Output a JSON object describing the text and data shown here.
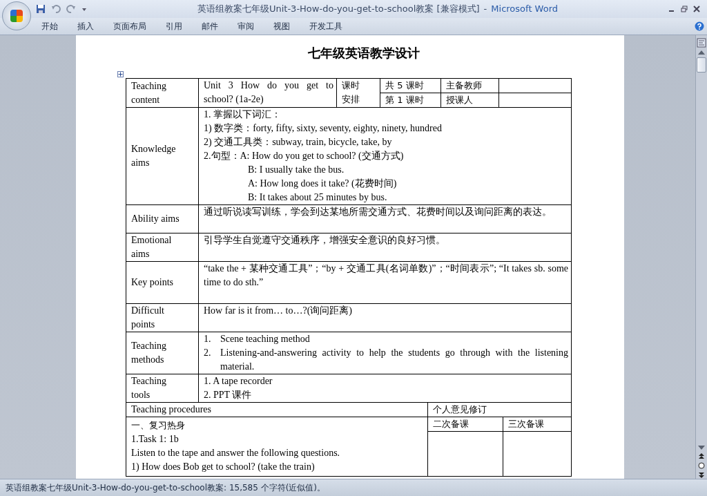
{
  "window": {
    "title": "英语组教案七年级Unit-3-How-do-you-get-to-school教案 [兼容模式]",
    "separator": "-",
    "app_name": "Microsoft Word"
  },
  "ribbon_tabs": [
    "开始",
    "插入",
    "页面布局",
    "引用",
    "邮件",
    "审阅",
    "视图",
    "开发工具"
  ],
  "document": {
    "title": "七年级英语教学设计",
    "header": {
      "label": [
        "Teaching",
        "content"
      ],
      "unit": "Unit 3 How do you get to school? (1a-2e)",
      "schedule": [
        "课时",
        "安排"
      ],
      "total": "共 5 课时",
      "current": "第 1 课时",
      "teacher_label": "主备教师",
      "lecturer_label": "授课人"
    },
    "rows": [
      {
        "label": [
          "Knowledge",
          "aims"
        ],
        "kind": "lines",
        "lines": [
          {
            "text": "1. 掌握以下词汇：",
            "indent": false
          },
          {
            "text": "1) 数字类：forty, fifty, sixty, seventy, eighty, ninety, hundred",
            "indent": false
          },
          {
            "text": "2) 交通工具类：subway, train, bicycle, take, by",
            "indent": false
          },
          {
            "text": "2.句型：A: How do you get to school?    (交通方式)",
            "indent": false
          },
          {
            "text": "B: I usually take the bus.",
            "indent": true
          },
          {
            "text": "A: How long does it take? (花费时间)",
            "indent": true
          },
          {
            "text": "B: It takes about 25 minutes by bus.",
            "indent": true
          }
        ]
      },
      {
        "label": [
          "Ability aims"
        ],
        "kind": "paragraph",
        "text": "通过听说读写训练，学会到达某地所需交通方式、花费时间以及询问距离的表达。"
      },
      {
        "label": [
          "Emotional",
          "aims"
        ],
        "kind": "paragraph",
        "text": "引导学生自觉遵守交通秩序，增强安全意识的良好习惯。"
      },
      {
        "label": [
          "Key points"
        ],
        "kind": "paragraph",
        "text": "“take the + 某种交通工具”；“by + 交通工具(名词单数)”；“时间表示”; “It takes sb. some time to do sth.”"
      },
      {
        "label": [
          "Difficult",
          "points"
        ],
        "kind": "paragraph",
        "text": "How far is it from… to…?(询问距离)"
      },
      {
        "label": [
          "Teaching",
          "methods"
        ],
        "kind": "numbered",
        "items": [
          {
            "number": "1.",
            "text": "Scene teaching method"
          },
          {
            "number": "2.",
            "text": "Listening-and-answering activity to help the students go through with the listening material."
          }
        ]
      },
      {
        "label": [
          "Teaching",
          "tools"
        ],
        "kind": "lines",
        "lines": [
          {
            "text": "1. A tape recorder",
            "indent": false
          },
          {
            "text": "2. PPT 课件",
            "indent": false
          }
        ]
      }
    ],
    "procedures": {
      "label": "Teaching procedures",
      "revision_label": "个人意见修订",
      "second": "二次备课",
      "third": "三次备课",
      "lines": [
        "一、复习热身",
        "1.Task 1: 1b",
        "Listen to the tape and answer the following questions.",
        "1) How does Bob get to school?    (take the train)"
      ]
    }
  },
  "status_bar": "英语组教案七年级Unit-3-How-do-you-get-to-school教案: 15,585 个字符(近似值)。"
}
